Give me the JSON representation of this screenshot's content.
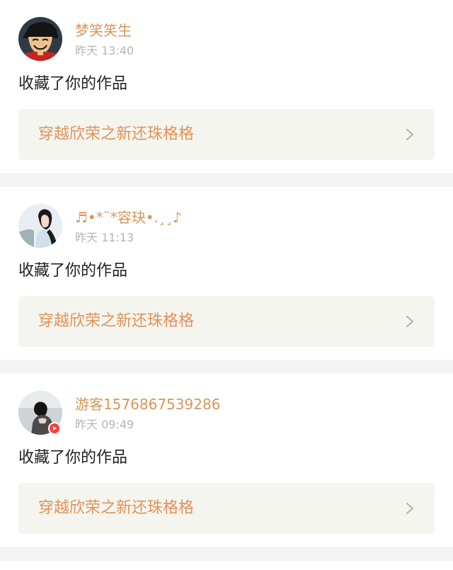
{
  "feed": {
    "items": [
      {
        "username": "梦笑笑生",
        "time": "昨天 13:40",
        "action": "收藏了你的作品",
        "work_title": "穿越欣荣之新还珠格格",
        "avatar_icon": "anime-avatar",
        "has_badge": false
      },
      {
        "username": "♬•*¨*容玦•.¸¸♪",
        "time": "昨天 11:13",
        "action": "收藏了你的作品",
        "work_title": "穿越欣荣之新还珠格格",
        "avatar_icon": "photo-avatar",
        "has_badge": false
      },
      {
        "username": "游客1576867539286",
        "time": "昨天 09:49",
        "action": "收藏了你的作品",
        "work_title": "穿越欣荣之新还珠格格",
        "avatar_icon": "photo-avatar",
        "has_badge": true
      }
    ]
  },
  "colors": {
    "username": "#d9965a",
    "work_title": "#e2925a",
    "time": "#b5b5b5",
    "action": "#222222",
    "card_bg": "#ffffff",
    "work_card_bg": "#f5f5ef",
    "divider": "#f4f4f4",
    "badge": "#ff3b3b"
  }
}
